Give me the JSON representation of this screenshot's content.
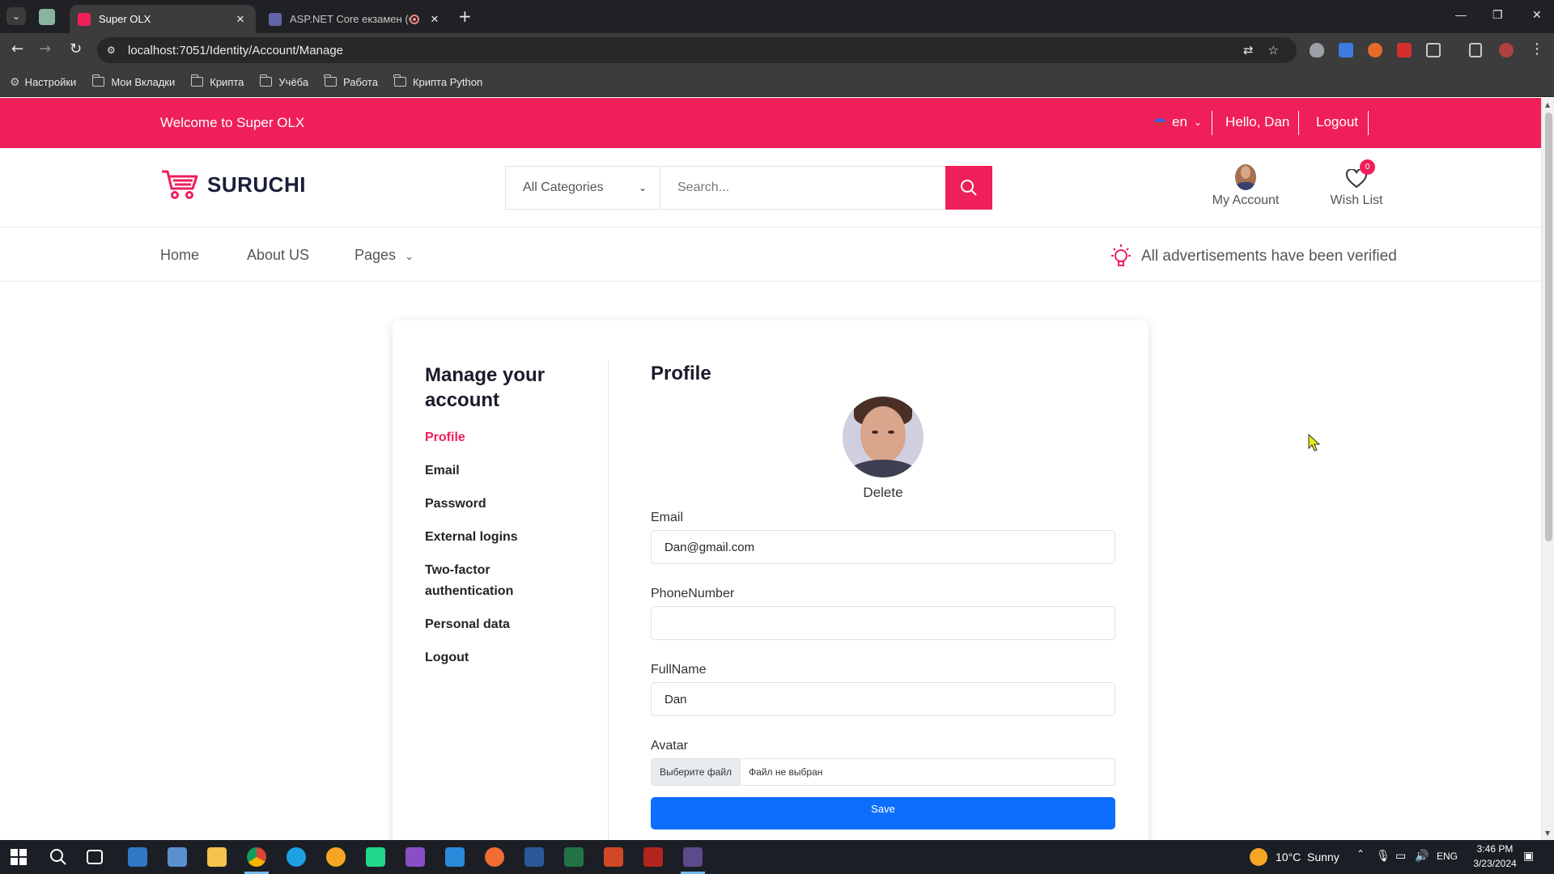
{
  "browser": {
    "tabs": [
      {
        "title": "Super OLX",
        "active": true
      },
      {
        "title": "ASP.NET Core екзамен (Co",
        "active": false
      }
    ],
    "url": "localhost:7051/Identity/Account/Manage",
    "bookmarks": [
      "Настройки",
      "Мои Вкладки",
      "Крипта",
      "Учёба",
      "Работа",
      "Крипта Python"
    ]
  },
  "site": {
    "topbar": {
      "welcome": "Welcome to Super OLX",
      "language": "en",
      "greeting": "Hello, Dan",
      "logout": "Logout"
    },
    "header": {
      "brand": "SURUCHI",
      "category_select": "All Categories",
      "search_placeholder": "Search...",
      "account_label": "My Account",
      "wishlist_label": "Wish List",
      "wishlist_count": "0"
    },
    "nav": {
      "items": [
        "Home",
        "About US",
        "Pages"
      ],
      "notice": "All advertisements have been verified"
    },
    "manage": {
      "heading": "Manage your account",
      "menu": [
        {
          "label": "Profile",
          "active": true
        },
        {
          "label": "Email",
          "active": false
        },
        {
          "label": "Password",
          "active": false
        },
        {
          "label": "External logins",
          "active": false
        },
        {
          "label": "Two-factor authentication",
          "active": false
        },
        {
          "label": "Personal data",
          "active": false
        },
        {
          "label": "Logout",
          "active": false
        }
      ]
    },
    "profile": {
      "title": "Profile",
      "delete_label": "Delete",
      "email_label": "Email",
      "email_value": "Dan@gmail.com",
      "phone_label": "PhoneNumber",
      "phone_value": "",
      "fullname_label": "FullName",
      "fullname_value": "Dan",
      "avatar_label": "Avatar",
      "file_button": "Выберите файл",
      "file_status": "Файл не выбран",
      "save_label": "Save"
    }
  },
  "taskbar": {
    "weather_temp": "10°C",
    "weather_text": "Sunny",
    "language": "ENG",
    "time": "3:46 PM",
    "date": "3/23/2024"
  },
  "colors": {
    "accent": "#ef1f5a",
    "save_button": "#0d6efd"
  }
}
